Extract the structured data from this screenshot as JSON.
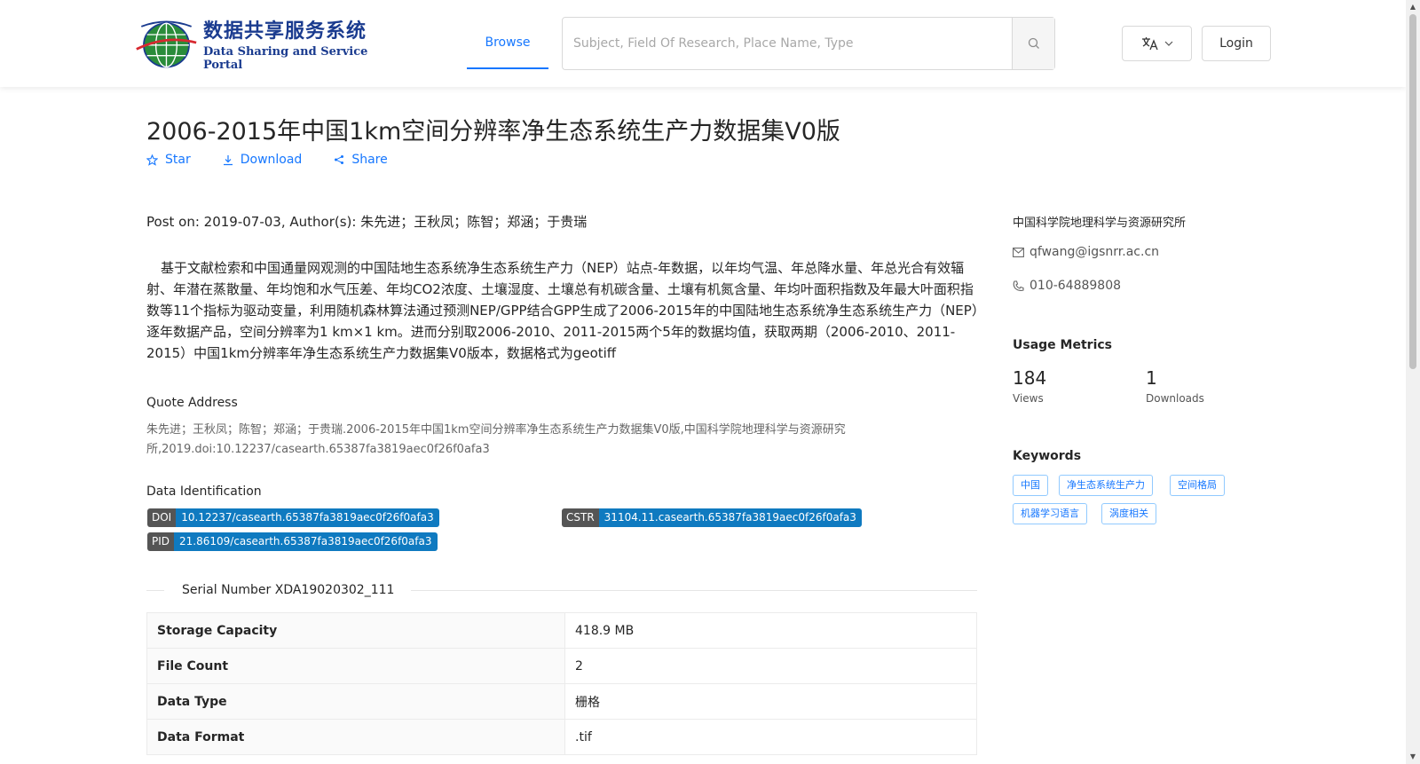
{
  "header": {
    "logo_cn": "数据共享服务系统",
    "logo_en": "Data Sharing and Service Portal",
    "nav_browse": "Browse",
    "search_placeholder": "Subject, Field Of Research, Place Name, Type",
    "login": "Login",
    "accent": "#1677ff"
  },
  "dataset": {
    "title": "2006-2015年中国1km空间分辨率净生态系统生产力数据集V0版",
    "actions": {
      "star": "Star",
      "download": "Download",
      "share": "Share"
    },
    "meta_line": "Post on: 2019-07-03, Author(s): 朱先进；王秋凤；陈智；郑涵；于贵瑞",
    "description": "基于文献检索和中国通量网观测的中国陆地生态系统净生态系统生产力（NEP）站点-年数据，以年均气温、年总降水量、年总光合有效辐射、年潜在蒸散量、年均饱和水气压差、年均CO2浓度、土壤湿度、土壤总有机碳含量、土壤有机氮含量、年均叶面积指数及年最大叶面积指数等11个指标为驱动变量，利用随机森林算法通过预测NEP/GPP结合GPP生成了2006-2015年的中国陆地生态系统净生态系统生产力（NEP）逐年数据产品，空间分辨率为1 km×1 km。进而分别取2006-2010、2011-2015两个5年的数据均值，获取两期（2006-2010、2011-2015）中国1km分辨率年净生态系统生产力数据集V0版本，数据格式为geotiff",
    "quote_label": "Quote Address",
    "quote_text": "朱先进；王秋凤；陈智；郑涵；于贵瑞.2006-2015年中国1km空间分辨率净生态系统生产力数据集V0版,中国科学院地理科学与资源研究所,2019.doi:10.12237/casearth.65387fa3819aec0f26f0afa3",
    "identification_label": "Data Identification",
    "ids": {
      "doi_key": "DOI",
      "doi_val": "10.12237/casearth.65387fa3819aec0f26f0afa3",
      "cstr_key": "CSTR",
      "cstr_val": "31104.11.casearth.65387fa3819aec0f26f0afa3",
      "pid_key": "PID",
      "pid_val": "21.86109/casearth.65387fa3819aec0f26f0afa3"
    },
    "serial": "Serial Number XDA19020302_111",
    "specs": [
      {
        "key": "Storage Capacity",
        "value": "418.9 MB"
      },
      {
        "key": "File Count",
        "value": "2"
      },
      {
        "key": "Data Type",
        "value": "栅格"
      },
      {
        "key": "Data Format",
        "value": ".tif"
      }
    ]
  },
  "sidebar": {
    "org": "中国科学院地理科学与资源研究所",
    "email": "qfwang@igsnrr.ac.cn",
    "phone": "010-64889808",
    "metrics_title": "Usage Metrics",
    "views": "184",
    "views_label": "Views",
    "downloads": "1",
    "downloads_label": "Downloads",
    "keywords_title": "Keywords",
    "keywords": [
      "中国",
      "净生态系统生产力",
      "空间格局",
      "机器学习语言",
      "涡度相关"
    ]
  }
}
